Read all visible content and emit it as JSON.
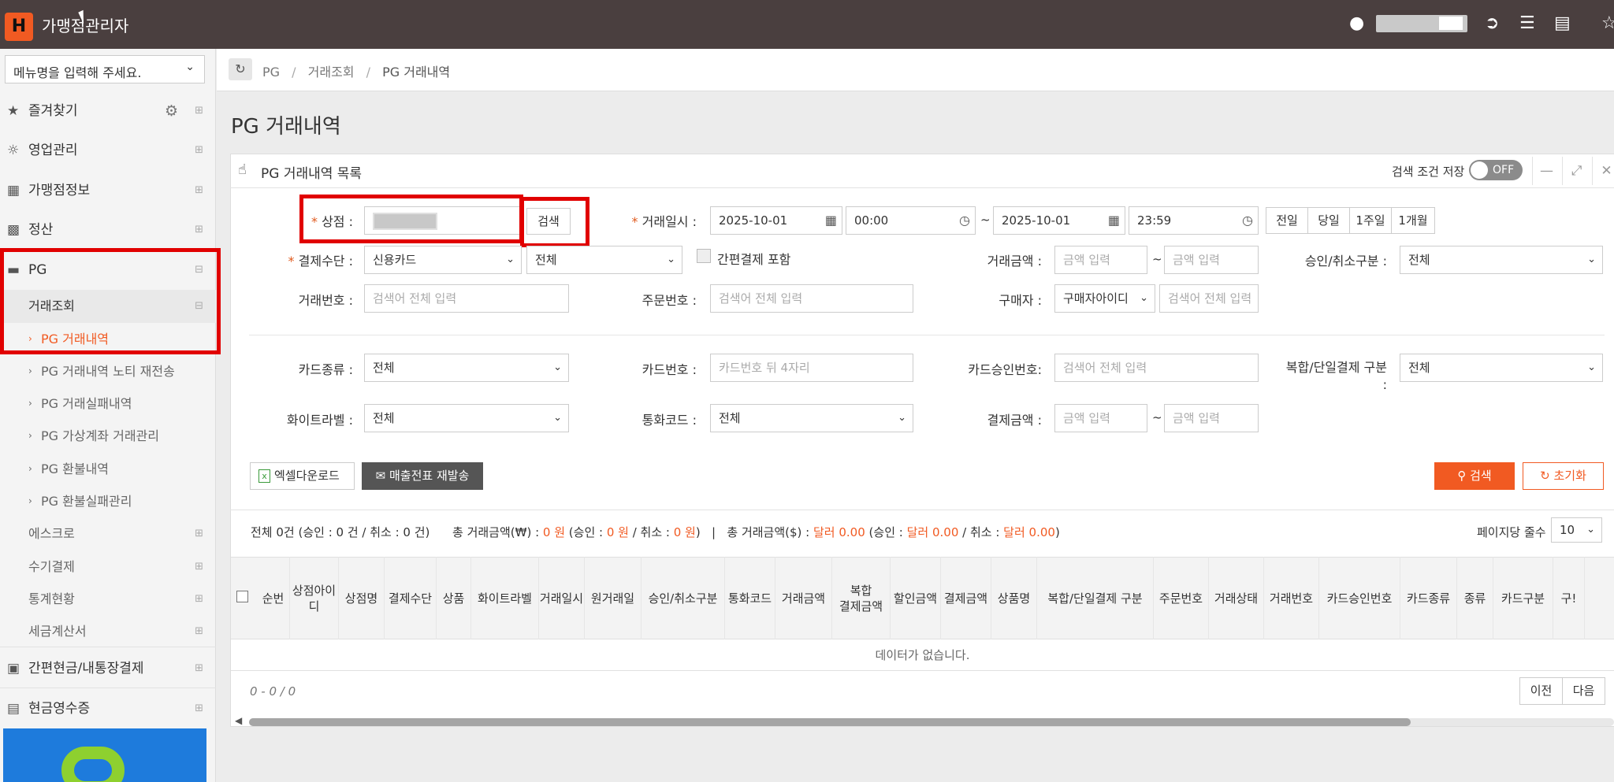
{
  "app": {
    "logo_letter": "H",
    "title": "가맹점관리자"
  },
  "topbar": {
    "icons": [
      "user-icon",
      "logout-icon",
      "menu-icon",
      "book-icon",
      "star-icon"
    ]
  },
  "sidebar": {
    "menu_search_placeholder": "메뉴명을 입력해 주세요.",
    "items": [
      {
        "label": "즐겨찾기",
        "icon": "star-icon"
      },
      {
        "label": "영업관리",
        "icon": "handshake-icon"
      },
      {
        "label": "가맹점정보",
        "icon": "building-icon"
      },
      {
        "label": "정산",
        "icon": "calculator-icon"
      },
      {
        "label": "PG",
        "icon": "credit-card-icon"
      }
    ],
    "pg_sub": {
      "label": "거래조회"
    },
    "pg_children": [
      "PG 거래내역",
      "PG 거래내역 노티 재전송",
      "PG 거래실패내역",
      "PG 가상계좌 거래관리",
      "PG 환불내역",
      "PG 환불실패관리"
    ],
    "pg_sub_items": [
      "에스크로",
      "수기결제",
      "통계현황",
      "세금계산서"
    ],
    "bottom_items": [
      {
        "label": "간편현금/내통장결제",
        "icon": "money-icon"
      },
      {
        "label": "현금영수증",
        "icon": "receipt-icon"
      }
    ]
  },
  "breadcrumb": [
    "PG",
    "거래조회",
    "PG 거래내역"
  ],
  "page_title": "PG 거래내역",
  "panel": {
    "title": "PG 거래내역 목록",
    "save_label": "검색 조건 저장",
    "toggle": "OFF"
  },
  "filters": {
    "store_label": "상점 :",
    "store_search_btn": "검색",
    "date_label": "거래일시 :",
    "date_from": "2025-10-01",
    "time_from": "00:00",
    "date_to": "2025-10-01",
    "time_to": "23:59",
    "tilde": "~",
    "quick": [
      "전일",
      "당일",
      "1주일",
      "1개월"
    ],
    "pay_method_label": "결제수단 :",
    "pay_method": "신용카드",
    "pay_method_sub": "전체",
    "simple_pay_label": "간편결제 포함",
    "amount_label": "거래금액 :",
    "amount_placeholder": "금액 입력",
    "approval_label": "승인/취소구분 :",
    "approval_value": "전체",
    "txn_no_label": "거래번호 :",
    "search_all_placeholder": "검색어 전체 입력",
    "order_no_label": "주문번호 :",
    "buyer_label": "구매자 :",
    "buyer_type": "구매자아이디",
    "card_type_label": "카드종류 :",
    "card_type_value": "전체",
    "card_no_label": "카드번호 :",
    "card_no_placeholder": "카드번호 뒤 4자리",
    "card_auth_label": "카드승인번호:",
    "combo_label_1": "복합/단일결제 구분",
    "combo_label_2": ":",
    "combo_value": "전체",
    "whitelabel_label": "화이트라벨 :",
    "whitelabel_value": "전체",
    "currency_label": "통화코드 :",
    "currency_value": "전체",
    "pay_amount_label": "결제금액 :"
  },
  "actions": {
    "excel": "엑셀다운로드",
    "resend": "매출전표 재발송",
    "search": "검색",
    "reset": "초기화"
  },
  "summary": {
    "p1": "전체 0건 (승인 : 0 건 / 취소 : 0 건)",
    "p2": "총 거래금액(₩) : ",
    "krw_total": "0 원",
    "p3": " (승인 : ",
    "krw_approved": "0 원",
    "p4": " / 취소 : ",
    "krw_cancel": "0 원",
    "p5": ")   |   총 거래금액($) : ",
    "usd_total": "달러 0.00",
    "p6": " (승인 : ",
    "usd_approved": "달러 0.00",
    "p7": " / 취소 : ",
    "usd_cancel": "달러 0.00",
    "p8": ")",
    "per_page_label": "페이지당 줄수",
    "per_page": "10"
  },
  "table": {
    "columns": [
      "순번",
      "상점아이디",
      "상점명",
      "결제수단",
      "상품",
      "화이트라벨",
      "거래일시",
      "원거래일",
      "승인/취소구분",
      "통화코드",
      "거래금액",
      "복합\n결제금액",
      "할인금액",
      "결제금액",
      "상품명",
      "복합/단일결제 구분",
      "주문번호",
      "거래상태",
      "거래번호",
      "카드승인번호",
      "카드종류",
      "종류",
      "카드구분",
      "구!"
    ],
    "empty": "데이터가 없습니다."
  },
  "pagination": {
    "count": "0 - 0 / 0",
    "prev": "이전",
    "next": "다음"
  }
}
